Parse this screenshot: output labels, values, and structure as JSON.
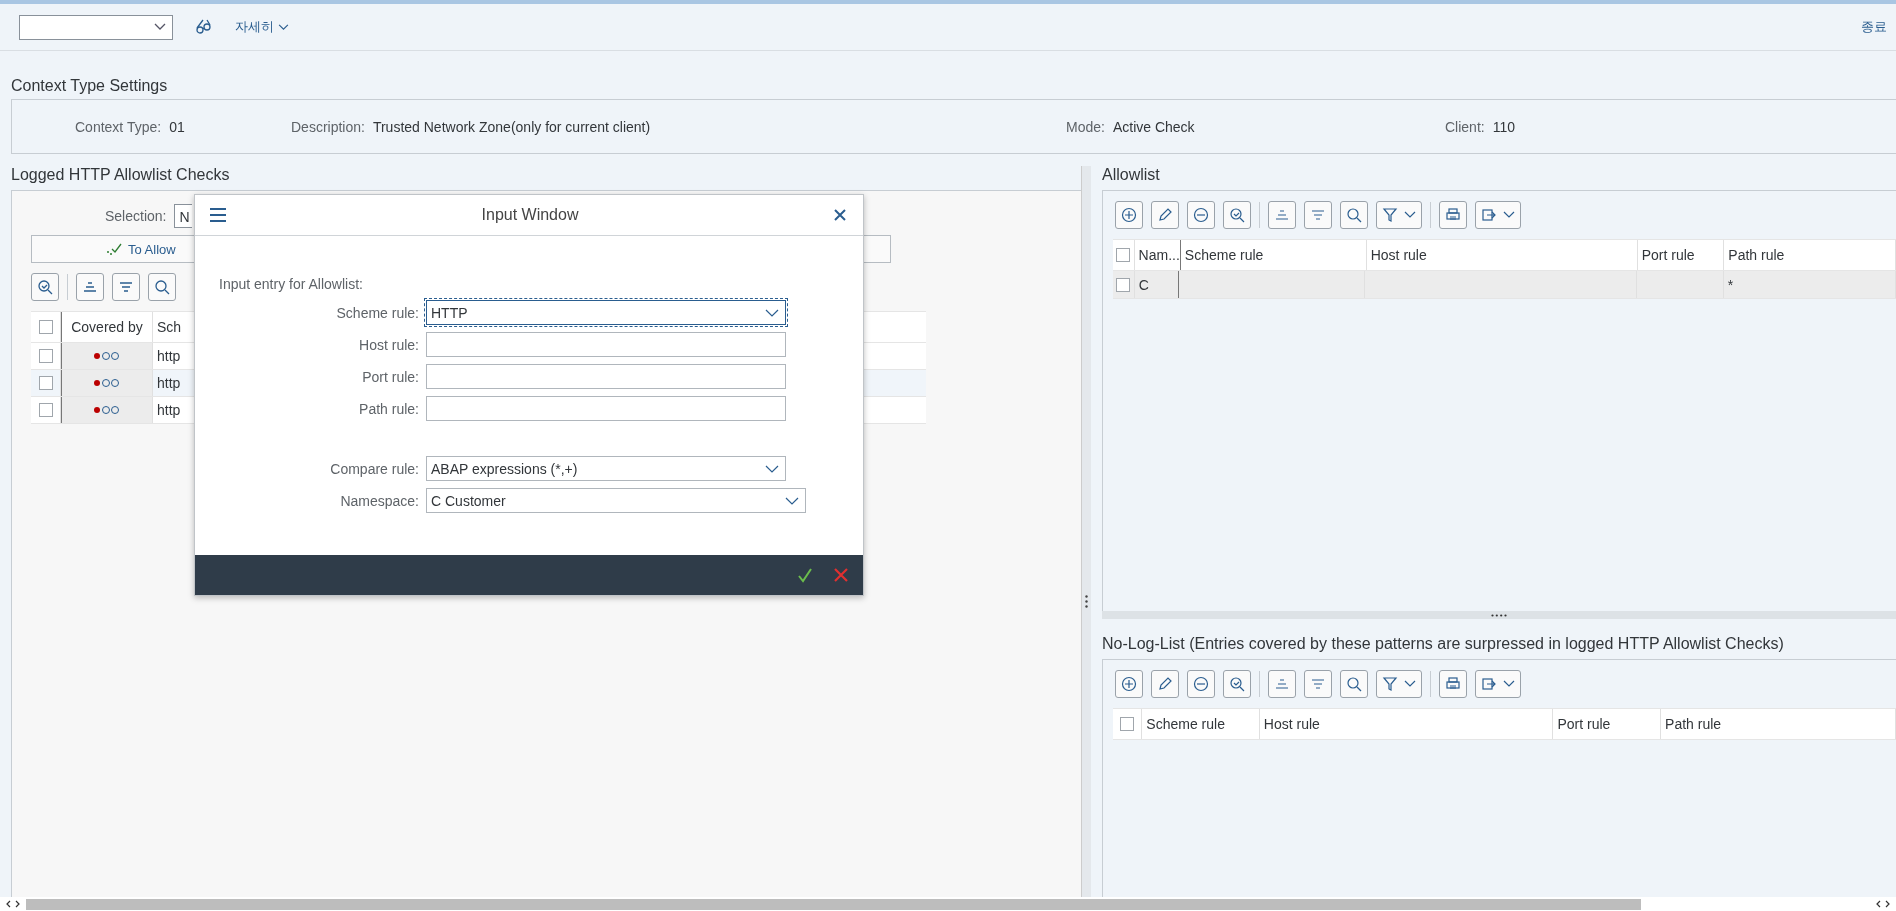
{
  "toolbar": {
    "details": "자세히",
    "exit": "종료"
  },
  "context": {
    "title": "Context Type Settings",
    "fields": [
      {
        "label": "Context Type:",
        "value": "01"
      },
      {
        "label": "Description:",
        "value": "Trusted Network Zone(only for current client)"
      },
      {
        "label": "Mode:",
        "value": "Active Check"
      },
      {
        "label": "Client:",
        "value": "110"
      }
    ]
  },
  "logged": {
    "title": "Logged HTTP Allowlist Checks",
    "selection_label": "Selection:",
    "selection_value": "N",
    "button": "To Allow",
    "select_all_checked": false,
    "columns": [
      "Covered by",
      "Sch"
    ],
    "rows": [
      {
        "scheme": "http",
        "checked": false
      },
      {
        "scheme": "http",
        "checked": false
      },
      {
        "scheme": "http",
        "checked": false
      }
    ]
  },
  "dialog": {
    "title": "Input Window",
    "intro": "Input entry for Allowlist:",
    "fields": [
      {
        "label": "Scheme rule:",
        "value": "HTTP",
        "kind": "dropdown",
        "focused": true
      },
      {
        "label": "Host rule:",
        "kind": "text",
        "focused": false
      },
      {
        "label": "Port rule:",
        "kind": "text",
        "focused": false
      },
      {
        "label": "Path rule:",
        "kind": "text",
        "focused": false
      }
    ],
    "settings": [
      {
        "label": "Compare rule:",
        "value": "ABAP expressions (*,+)",
        "kind": "dropdown",
        "focused": false
      },
      {
        "label": "Namespace:",
        "value": "C Customer",
        "kind": "dropdown",
        "focused": false
      }
    ]
  },
  "allowlist": {
    "title": "Allowlist",
    "select_all_checked": false,
    "columns": [
      "Nam...",
      "Scheme rule",
      "Host rule",
      "Port rule",
      "Path rule"
    ],
    "rows": [
      {
        "name": "C",
        "path_rule": "*",
        "checked": false
      }
    ]
  },
  "nolog": {
    "title": "No-Log-List (Entries covered by these patterns are surpressed in logged HTTP Allowlist Checks)",
    "select_all_checked": false,
    "columns": [
      "Scheme rule",
      "Host rule",
      "Port rule",
      "Path rule"
    ]
  }
}
